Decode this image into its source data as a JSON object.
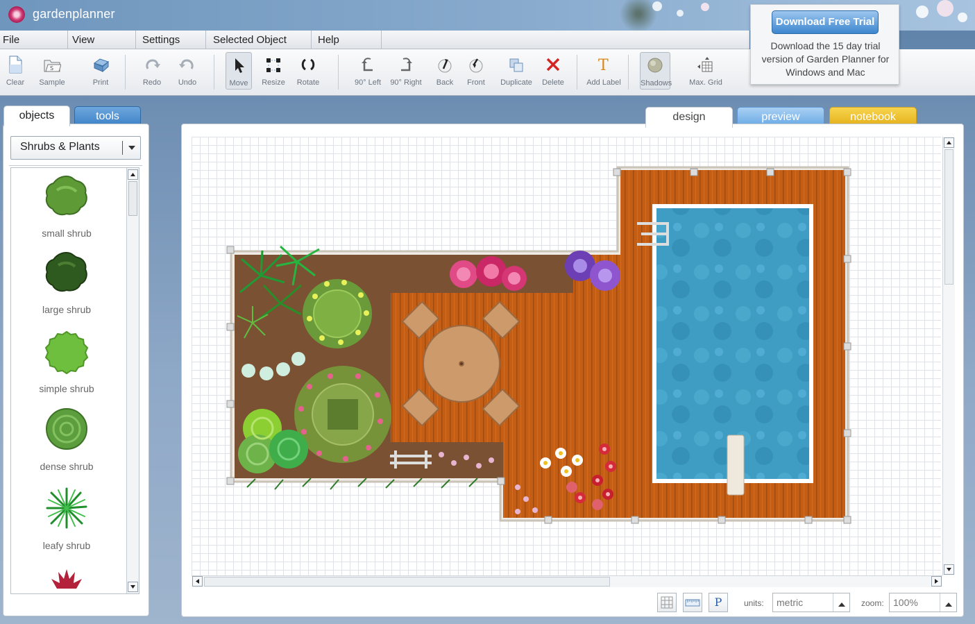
{
  "app": {
    "name": "gardenplanner"
  },
  "menu": [
    "File",
    "View",
    "Settings",
    "Selected Object",
    "Help"
  ],
  "toolbar": {
    "clear": "Clear",
    "sample": "Sample",
    "print": "Print",
    "redo": "Redo",
    "undo": "Undo",
    "move": "Move",
    "resize": "Resize",
    "rotate": "Rotate",
    "left90": "90° Left",
    "right90": "90° Right",
    "back": "Back",
    "front": "Front",
    "duplicate": "Duplicate",
    "delete": "Delete",
    "add_label": "Add Label",
    "shadows": "Shadows",
    "max_grid": "Max. Grid"
  },
  "trial": {
    "button": "Download Free Trial",
    "text": "Download the 15 day trial version of Garden Planner for Windows and Mac"
  },
  "left_tabs": {
    "objects": "objects",
    "tools": "tools"
  },
  "category": {
    "selected": "Shrubs & Plants"
  },
  "objects": [
    {
      "label": "small shrub",
      "icon": "small-shrub-icon",
      "color": "#5e9a36"
    },
    {
      "label": "large shrub",
      "icon": "large-shrub-icon",
      "color": "#2f5a1f"
    },
    {
      "label": "simple shrub",
      "icon": "simple-shrub-icon",
      "color": "#6fbf3e"
    },
    {
      "label": "dense shrub",
      "icon": "dense-shrub-icon",
      "color": "#5c9e3d"
    },
    {
      "label": "leafy shrub",
      "icon": "leafy-shrub-icon",
      "color": "#2aa63a"
    },
    {
      "label": "",
      "icon": "red-plant-icon",
      "color": "#b3223a"
    }
  ],
  "view_tabs": {
    "design": "design",
    "preview": "preview",
    "notebook": "notebook"
  },
  "status": {
    "units_label": "units:",
    "units_value": "metric",
    "zoom_label": "zoom:",
    "zoom_value": "100%",
    "p_label": "P"
  },
  "colors": {
    "deck": "#c45e14",
    "pool": "#3f9dc4",
    "soil": "#7a5132",
    "accent": "#3d86cf",
    "notebook": "#e5b01a"
  }
}
